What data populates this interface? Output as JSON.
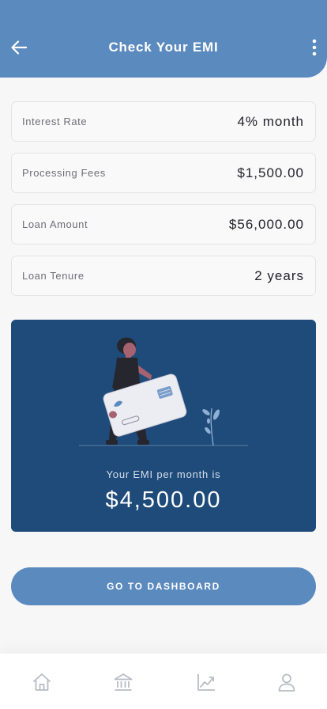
{
  "header": {
    "title": "Check Your EMI",
    "back_icon": "arrow-left-icon",
    "more_icon": "more-vertical-icon"
  },
  "fields": [
    {
      "label": "Interest Rate",
      "value": "4% month"
    },
    {
      "label": "Processing Fees",
      "value": "$1,500.00"
    },
    {
      "label": "Loan Amount",
      "value": "$56,000.00"
    },
    {
      "label": "Loan Tenure",
      "value": "2 years"
    }
  ],
  "emi": {
    "caption": "Your EMI per month is",
    "amount": "$4,500.00"
  },
  "actions": {
    "dashboard_label": "GO TO DASHBOARD"
  },
  "nav": {
    "items": [
      "home-icon",
      "bank-icon",
      "chart-icon",
      "profile-icon"
    ]
  },
  "colors": {
    "primary": "#5b8abf",
    "card": "#1f4b7a",
    "background": "#f7f7f8"
  }
}
